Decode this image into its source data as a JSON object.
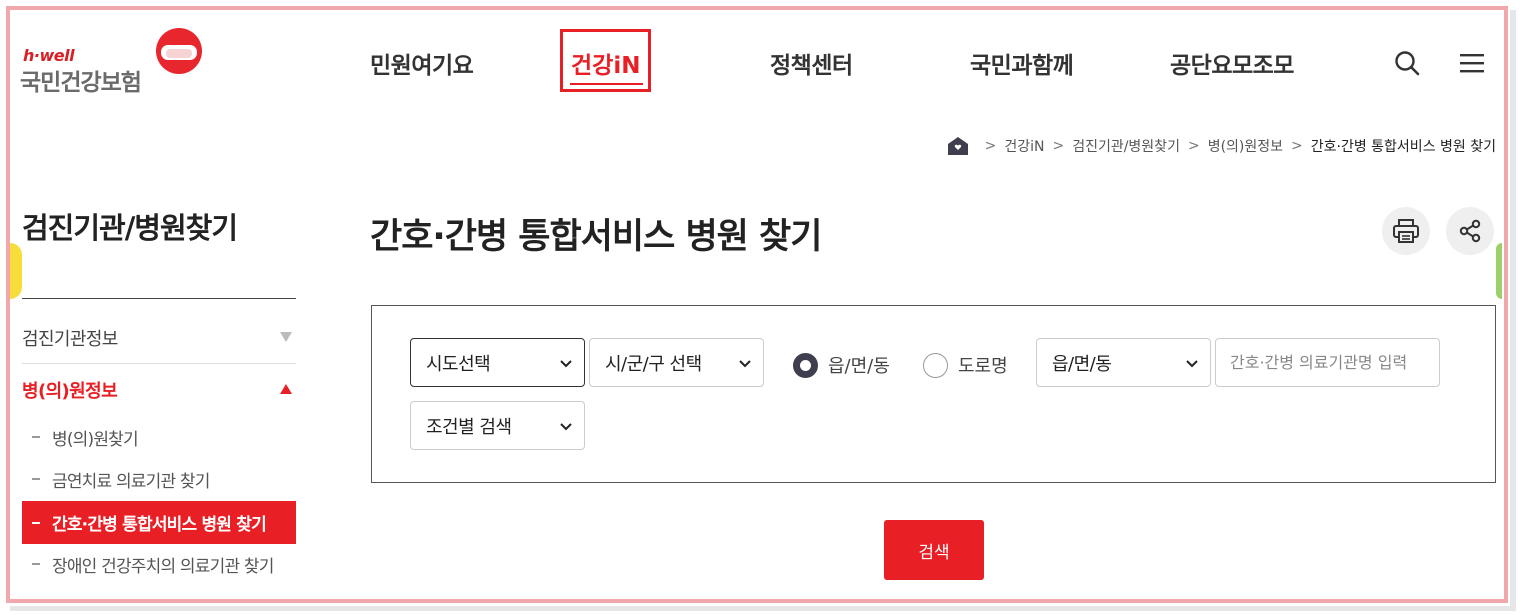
{
  "header": {
    "logo_sub": "h·well",
    "logo_main": "국민건강보험",
    "nav": [
      {
        "label": "민원여기요"
      },
      {
        "label": "건강iN",
        "active": true
      },
      {
        "label": "정책센터"
      },
      {
        "label": "국민과함께"
      },
      {
        "label": "공단요모조모"
      }
    ],
    "icons": [
      "search-icon",
      "menu-icon"
    ],
    "accent_color": "#e81f24"
  },
  "breadcrumb": {
    "items": [
      "건강iN",
      "검진기관/병원찾기",
      "병(의)원정보",
      "간호·간병 통합서비스 병원 찾기"
    ],
    "separator": ">"
  },
  "sidebar": {
    "title": "검진기관/병원찾기",
    "groups": [
      {
        "label": "검진기관정보",
        "expanded": false
      },
      {
        "label": "병(의)원정보",
        "expanded": true
      }
    ],
    "sub_items": [
      {
        "label": "병(의)원찾기"
      },
      {
        "label": "금연치료 의료기관 찾기"
      },
      {
        "label": "간호·간병 통합서비스 병원 찾기",
        "active": true
      },
      {
        "label": "장애인 건강주치의 의료기관 찾기"
      }
    ]
  },
  "main": {
    "title": "간호·간병 통합서비스 병원 찾기",
    "actions": [
      "print-icon",
      "share-icon"
    ],
    "search": {
      "sido_select": "시도선택",
      "sigungu_select": "시/군/구 선택",
      "radio_dong": "읍/면/동",
      "radio_road": "도로명",
      "radio_selected": "읍/면/동",
      "dong_select": "읍/면/동",
      "name_placeholder": "간호·간병 의료기관명 입력",
      "condition_select": "조건별 검색"
    },
    "search_button": "검색"
  }
}
